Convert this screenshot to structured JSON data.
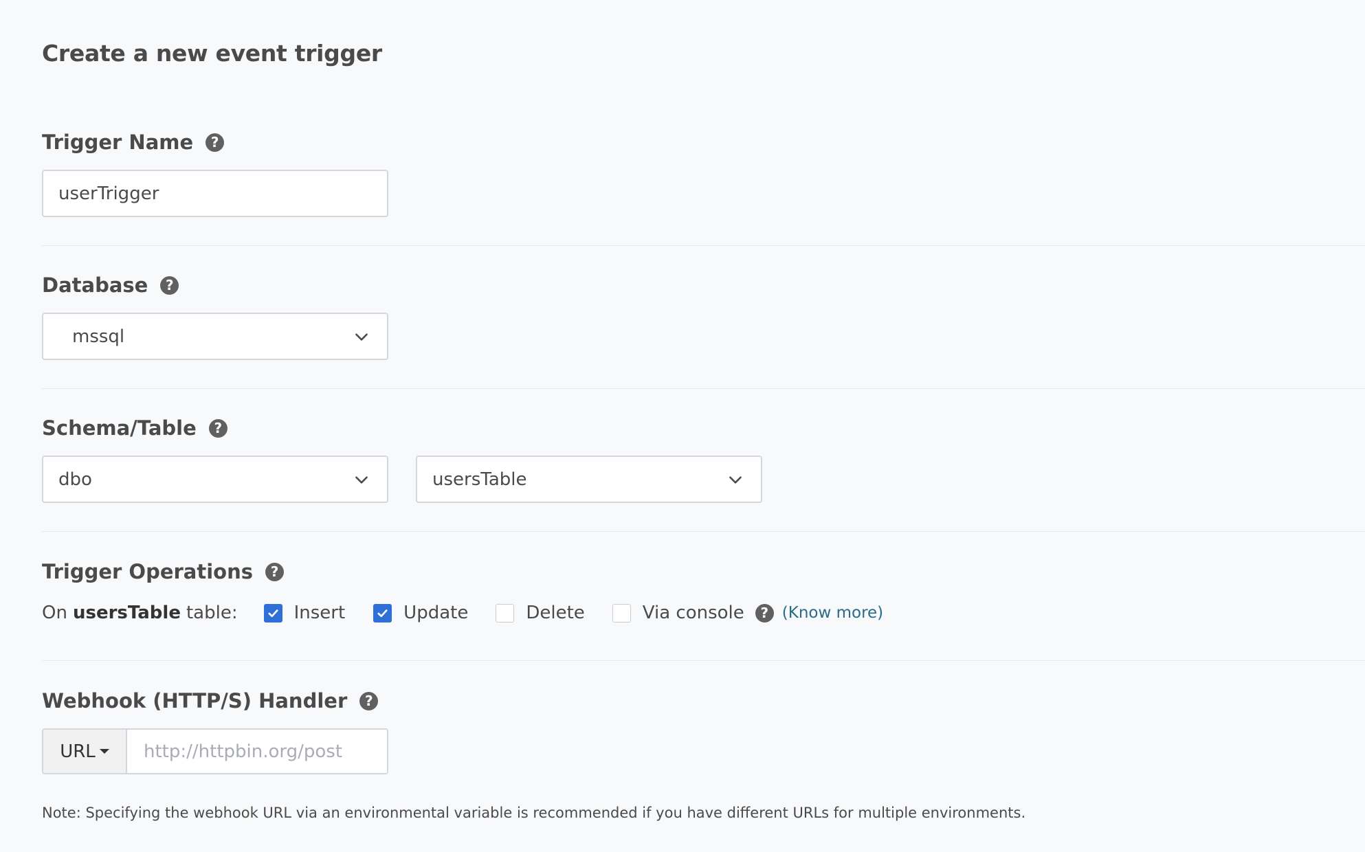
{
  "page_title": "Create a new event trigger",
  "trigger_name": {
    "label": "Trigger Name",
    "value": "userTrigger"
  },
  "database": {
    "label": "Database",
    "selected": "mssql"
  },
  "schema_table": {
    "label": "Schema/Table",
    "schema_selected": "dbo",
    "table_selected": "usersTable"
  },
  "trigger_operations": {
    "label": "Trigger Operations",
    "on_prefix": "On",
    "table_name": "usersTable",
    "on_suffix": "table:",
    "operations": [
      {
        "label": "Insert",
        "checked": true
      },
      {
        "label": "Update",
        "checked": true
      },
      {
        "label": "Delete",
        "checked": false
      },
      {
        "label": "Via console",
        "checked": false
      }
    ],
    "know_more": "(Know more)"
  },
  "webhook": {
    "label": "Webhook (HTTP/S) Handler",
    "type_selected": "URL",
    "placeholder": "http://httpbin.org/post",
    "value": ""
  },
  "note": "Note: Specifying the webhook URL via an environmental variable is recommended if you have different URLs for multiple environments.",
  "help_glyph": "?",
  "colors": {
    "checkbox_checked": "#2e6fd8",
    "link": "#2a6b8a",
    "background": "#f8f9fb"
  }
}
